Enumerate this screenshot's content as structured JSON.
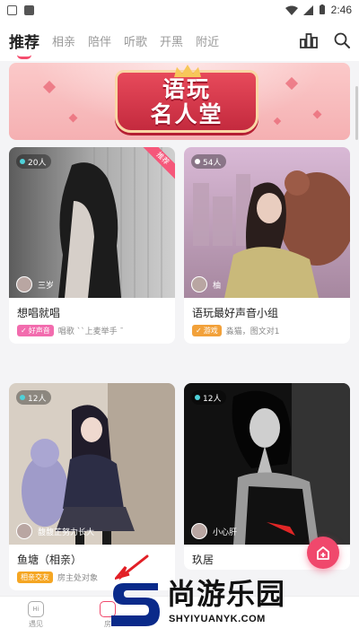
{
  "status_bar": {
    "time": "2:46"
  },
  "tabs": [
    {
      "label": "推荐",
      "active": true
    },
    {
      "label": "相亲",
      "active": false
    },
    {
      "label": "陪伴",
      "active": false
    },
    {
      "label": "听歌",
      "active": false
    },
    {
      "label": "开黑",
      "active": false
    },
    {
      "label": "附近",
      "active": false
    }
  ],
  "banner": {
    "title_line1": "语玩",
    "title_line2": "名人堂"
  },
  "cards": [
    {
      "title": "想唱就唱",
      "count": "20人",
      "host": "三岁",
      "corner_tag": "推荐",
      "chip_label": "好声音",
      "chip_color": "#f26cae",
      "desc": "唱歌 ˋˋ上麦举手 ˉ",
      "palette": [
        "#4a4a4a",
        "#b9b9b9"
      ]
    },
    {
      "title": "语玩最好声音小组",
      "count": "54人",
      "host": "柚",
      "corner_tag": "",
      "chip_label": "游戏",
      "chip_color": "#f2a13a",
      "desc": "淼猫，图文对1",
      "palette": [
        "#c7a7c3",
        "#9d6a5c"
      ]
    },
    {
      "title": "鱼塘（相亲）",
      "count": "12人",
      "host": "馥馥芷努力长大",
      "corner_tag": "",
      "chip_label": "相亲交友",
      "chip_color": "#f5a623",
      "desc": "房主处对象",
      "palette": [
        "#b3a597",
        "#2d2a3b"
      ]
    },
    {
      "title": "玖居",
      "count": "12人",
      "host": "小心肝",
      "corner_tag": "",
      "chip_label": "",
      "chip_color": "#999999",
      "desc": "",
      "palette": [
        "#1a1a1a",
        "#8d8d8d"
      ]
    }
  ],
  "bottom_nav": [
    {
      "label": "遇见"
    },
    {
      "label": "房"
    }
  ],
  "watermark": {
    "text": "尚游乐园",
    "url": "SHYIYUANYK.COM"
  }
}
